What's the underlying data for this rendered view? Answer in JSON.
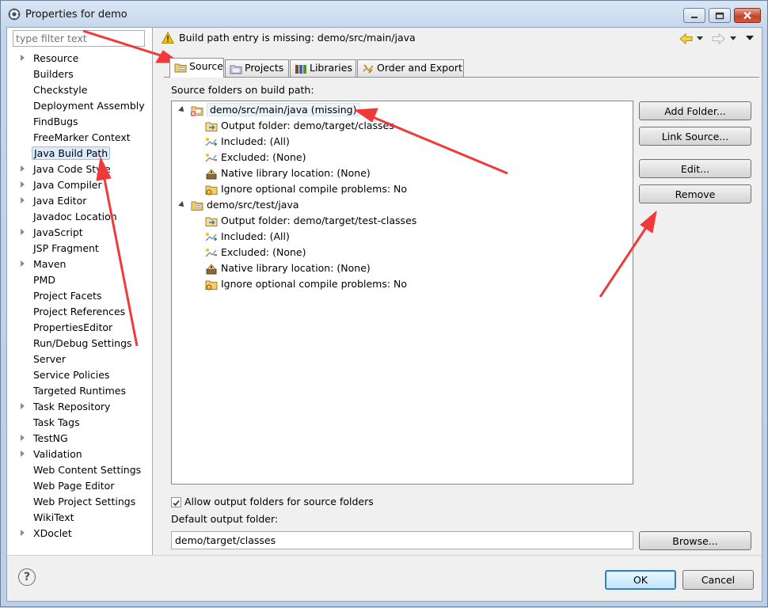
{
  "window": {
    "title": "Properties for demo"
  },
  "filter": {
    "placeholder": "type filter text"
  },
  "nav_tree": [
    {
      "label": "Resource",
      "expandable": true
    },
    {
      "label": "Builders",
      "expandable": false
    },
    {
      "label": "Checkstyle",
      "expandable": false
    },
    {
      "label": "Deployment Assembly",
      "expandable": false
    },
    {
      "label": "FindBugs",
      "expandable": false
    },
    {
      "label": "FreeMarker Context",
      "expandable": false
    },
    {
      "label": "Java Build Path",
      "expandable": false,
      "selected": true
    },
    {
      "label": "Java Code Style",
      "expandable": true
    },
    {
      "label": "Java Compiler",
      "expandable": true
    },
    {
      "label": "Java Editor",
      "expandable": true
    },
    {
      "label": "Javadoc Location",
      "expandable": false
    },
    {
      "label": "JavaScript",
      "expandable": true
    },
    {
      "label": "JSP Fragment",
      "expandable": false
    },
    {
      "label": "Maven",
      "expandable": true
    },
    {
      "label": "PMD",
      "expandable": false
    },
    {
      "label": "Project Facets",
      "expandable": false
    },
    {
      "label": "Project References",
      "expandable": false
    },
    {
      "label": "PropertiesEditor",
      "expandable": false
    },
    {
      "label": "Run/Debug Settings",
      "expandable": false
    },
    {
      "label": "Server",
      "expandable": false
    },
    {
      "label": "Service Policies",
      "expandable": false
    },
    {
      "label": "Targeted Runtimes",
      "expandable": false
    },
    {
      "label": "Task Repository",
      "expandable": true
    },
    {
      "label": "Task Tags",
      "expandable": false
    },
    {
      "label": "TestNG",
      "expandable": true
    },
    {
      "label": "Validation",
      "expandable": true
    },
    {
      "label": "Web Content Settings",
      "expandable": false
    },
    {
      "label": "Web Page Editor",
      "expandable": false
    },
    {
      "label": "Web Project Settings",
      "expandable": false
    },
    {
      "label": "WikiText",
      "expandable": false
    },
    {
      "label": "XDoclet",
      "expandable": true
    }
  ],
  "warning": {
    "text": "Build path entry is missing: demo/src/main/java"
  },
  "tabs": [
    {
      "label": "Source",
      "active": true
    },
    {
      "label": "Projects",
      "active": false
    },
    {
      "label": "Libraries",
      "active": false
    },
    {
      "label": "Order and Export",
      "active": false
    }
  ],
  "source_panel": {
    "label": "Source folders on build path:",
    "folders": [
      {
        "label": "demo/src/main/java (missing)",
        "children": [
          {
            "label": "Output folder: demo/target/classes",
            "icon": "output-folder-icon"
          },
          {
            "label": "Included: (All)",
            "icon": "inclusion-icon"
          },
          {
            "label": "Excluded: (None)",
            "icon": "exclusion-icon"
          },
          {
            "label": "Native library location: (None)",
            "icon": "native-library-icon"
          },
          {
            "label": "Ignore optional compile problems: No",
            "icon": "ignore-problems-icon"
          }
        ]
      },
      {
        "label": "demo/src/test/java",
        "children": [
          {
            "label": "Output folder: demo/target/test-classes",
            "icon": "output-folder-icon"
          },
          {
            "label": "Included: (All)",
            "icon": "inclusion-icon"
          },
          {
            "label": "Excluded: (None)",
            "icon": "exclusion-icon"
          },
          {
            "label": "Native library location: (None)",
            "icon": "native-library-icon"
          },
          {
            "label": "Ignore optional compile problems: No",
            "icon": "ignore-problems-icon"
          }
        ]
      }
    ],
    "buttons": {
      "add_folder": "Add Folder...",
      "link_source": "Link Source...",
      "edit": "Edit...",
      "remove": "Remove"
    },
    "allow_output_label": "Allow output folders for source folders",
    "allow_output_checked": true,
    "default_output_label": "Default output folder:",
    "default_output_value": "demo/target/classes",
    "browse": "Browse..."
  },
  "footer": {
    "help": "?",
    "ok": "OK",
    "cancel": "Cancel"
  },
  "colors": {
    "annotation_arrow": "#f03a3a",
    "selection": "#dceaf9",
    "warning": "#f5c400"
  }
}
